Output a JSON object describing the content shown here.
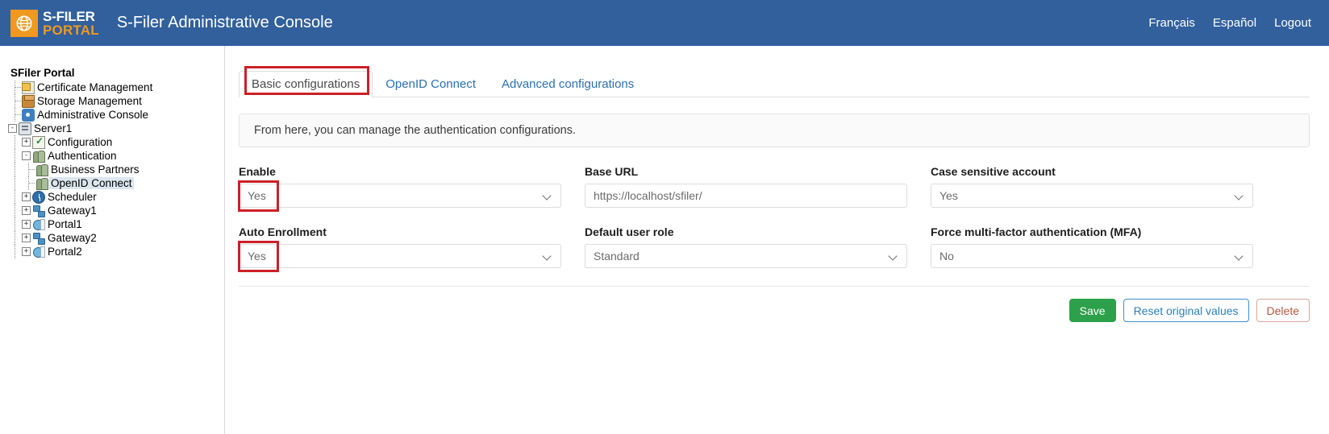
{
  "header": {
    "logo_line1": "S-FILER",
    "logo_line2": "PORTAL",
    "logo_icon": "globe-icon",
    "app_title": "S-Filer Administrative Console",
    "links": [
      {
        "label": "Français",
        "name": "lang-francais"
      },
      {
        "label": "Español",
        "name": "lang-espanol"
      },
      {
        "label": "Logout",
        "name": "logout"
      }
    ],
    "background": "#31609c",
    "accent": "#f0981f"
  },
  "sidebar": {
    "root_label": "SFiler Portal",
    "nodes": [
      {
        "label": "Certificate Management",
        "icon": "certificate-icon",
        "depth": 1,
        "toggle": "",
        "selected": false
      },
      {
        "label": "Storage Management",
        "icon": "storage-box-icon",
        "depth": 1,
        "toggle": "",
        "selected": false
      },
      {
        "label": "Administrative Console",
        "icon": "gear-icon",
        "depth": 1,
        "toggle": "",
        "selected": false
      },
      {
        "label": "Server1",
        "icon": "server-icon",
        "depth": 0,
        "toggle": "-",
        "selected": false
      },
      {
        "label": "Configuration",
        "icon": "config-check-icon",
        "depth": 1,
        "toggle": "+",
        "selected": false
      },
      {
        "label": "Authentication",
        "icon": "users-icon",
        "depth": 1,
        "toggle": "-",
        "selected": false
      },
      {
        "label": "Business Partners",
        "icon": "users-icon",
        "depth": 2,
        "toggle": "",
        "selected": false
      },
      {
        "label": "OpenID Connect",
        "icon": "users-icon",
        "depth": 2,
        "toggle": "",
        "selected": true
      },
      {
        "label": "Scheduler",
        "icon": "clock-icon",
        "depth": 1,
        "toggle": "+",
        "selected": false
      },
      {
        "label": "Gateway1",
        "icon": "gateway-icon",
        "depth": 1,
        "toggle": "+",
        "selected": false
      },
      {
        "label": "Portal1",
        "icon": "portal-icon",
        "depth": 1,
        "toggle": "+",
        "selected": false
      },
      {
        "label": "Gateway2",
        "icon": "gateway-icon",
        "depth": 1,
        "toggle": "+",
        "selected": false
      },
      {
        "label": "Portal2",
        "icon": "portal-icon",
        "depth": 1,
        "toggle": "+",
        "selected": false
      }
    ]
  },
  "main": {
    "tabs": [
      {
        "label": "Basic configurations",
        "active": true,
        "highlighted": true
      },
      {
        "label": "OpenID Connect",
        "active": false,
        "highlighted": false
      },
      {
        "label": "Advanced configurations",
        "active": false,
        "highlighted": false
      }
    ],
    "info_text": "From here, you can manage the authentication configurations.",
    "fields": [
      {
        "label": "Enable",
        "type": "select",
        "value": "Yes",
        "name": "enable-select",
        "highlighted": true
      },
      {
        "label": "Base URL",
        "type": "text",
        "value": "https://localhost/sfiler/",
        "placeholder": "https://localhost/sfiler/",
        "name": "base-url-input",
        "highlighted": false
      },
      {
        "label": "Case sensitive account",
        "type": "select",
        "value": "Yes",
        "name": "case-sensitive-account-select",
        "highlighted": false
      },
      {
        "label": "Auto Enrollment",
        "type": "select",
        "value": "Yes",
        "name": "auto-enrollment-select",
        "highlighted": true
      },
      {
        "label": "Default user role",
        "type": "select",
        "value": "Standard",
        "name": "default-user-role-select",
        "highlighted": false
      },
      {
        "label": "Force multi-factor authentication (MFA)",
        "type": "select",
        "value": "No",
        "name": "force-mfa-select",
        "highlighted": false
      }
    ],
    "buttons": {
      "save": "Save",
      "reset": "Reset original values",
      "delete": "Delete"
    }
  },
  "annotation_color": "#cc2026"
}
